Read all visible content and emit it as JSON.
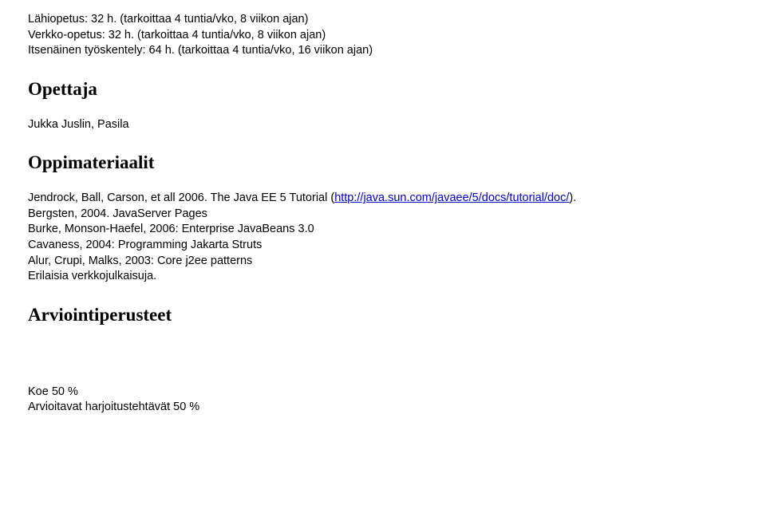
{
  "hours": {
    "lahiopetus": "Lähiopetus: 32 h. (tarkoittaa 4 tuntia/vko, 8 viikon ajan)",
    "verkkoopetus": "Verkko-opetus: 32 h. (tarkoittaa 4 tuntia/vko, 8 viikon ajan)",
    "itsenaineen": "Itsenäinen työskentely: 64 h. (tarkoittaa 4 tuntia/vko, 16 viikon ajan)"
  },
  "headings": {
    "opettaja": "Opettaja",
    "oppimateriaalit": "Oppimateriaalit",
    "arviointi": "Arviointiperusteet"
  },
  "teacher": "Jukka Juslin, Pasila",
  "materials": {
    "line1_pre": "Jendrock, Ball, Carson, et all 2006. The Java EE 5 Tutorial (",
    "line1_link": "http://java.sun.com/javaee/5/docs/tutorial/doc/",
    "line1_post": ").",
    "line2": "Bergsten, 2004. JavaServer Pages",
    "line3": "Burke, Monson-Haefel, 2006: Enterprise JavaBeans 3.0",
    "line4": "Cavaness, 2004: Programming Jakarta Struts",
    "line5": "Alur, Crupi, Malks, 2003: Core j2ee patterns",
    "line6": "Erilaisia verkkojulkaisuja."
  },
  "assessment": {
    "line1": "Koe 50 %",
    "line2": "Arvioitavat harjoitustehtävät 50 %"
  }
}
